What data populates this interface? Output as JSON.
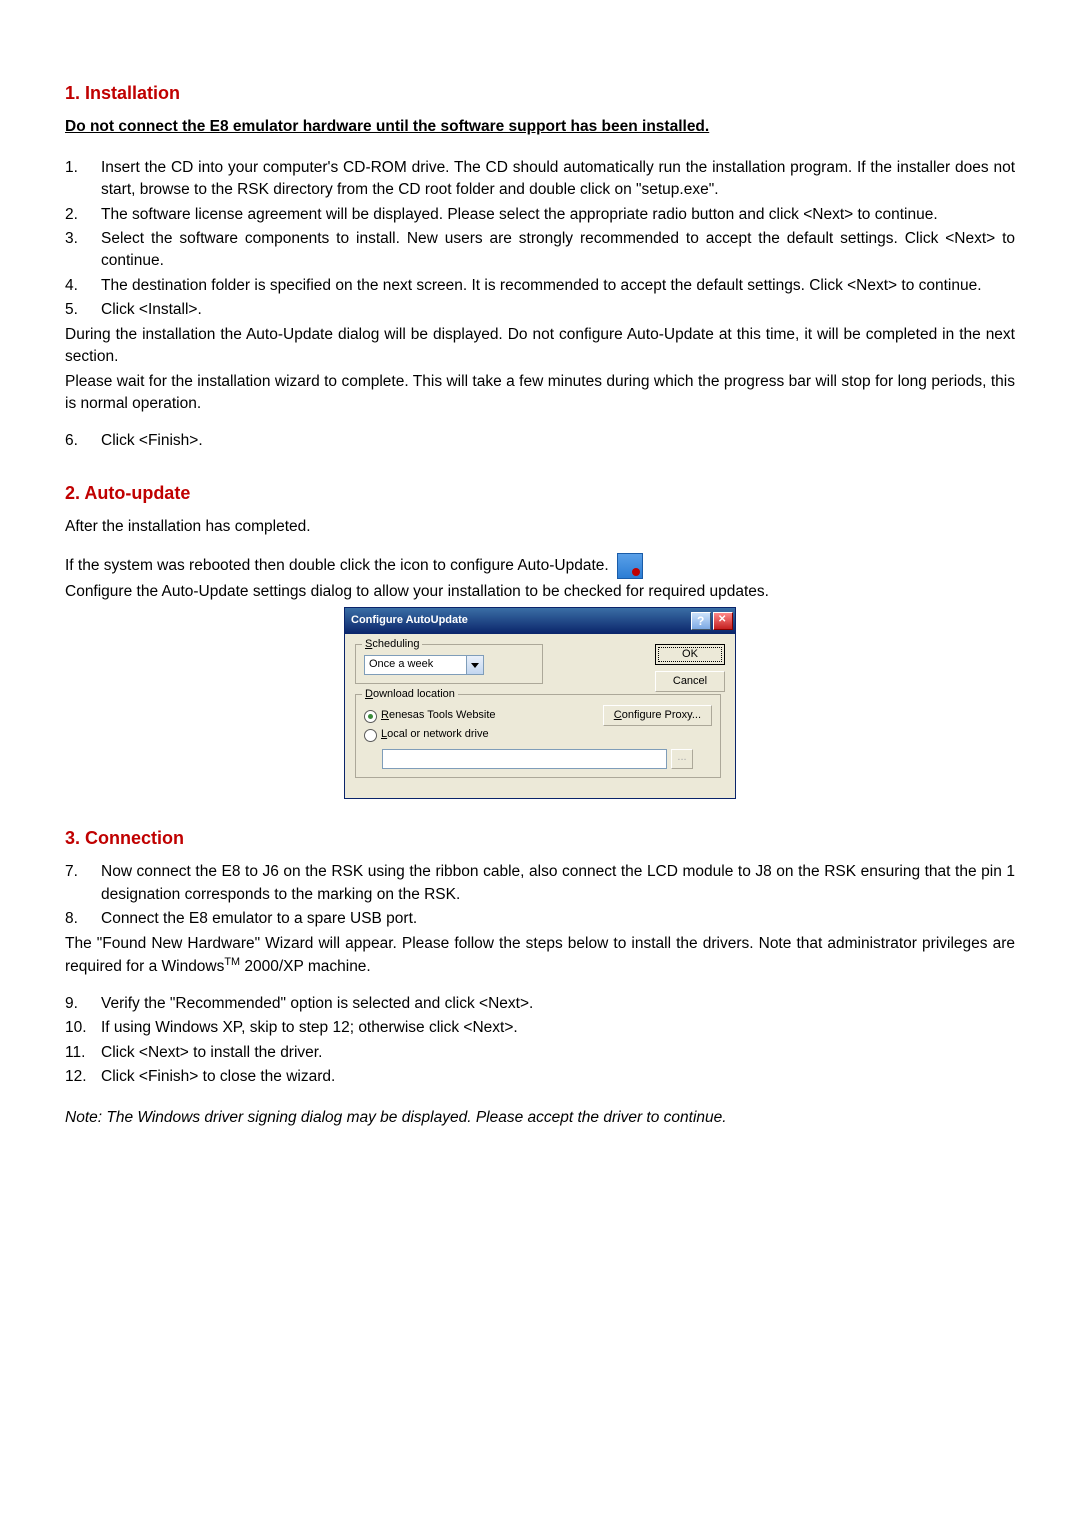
{
  "sections": {
    "s1": {
      "heading": "1. Installation"
    },
    "s2": {
      "heading": "2. Auto-update"
    },
    "s3": {
      "heading": "3. Connection"
    }
  },
  "warning": "Do not connect the E8 emulator hardware until the software support has been installed.",
  "list1": {
    "n1": "1.",
    "n2": "2.",
    "n3": "3.",
    "n4": "4.",
    "n5": "5.",
    "n6": "6.",
    "i1": "Insert the CD into your computer's CD-ROM drive. The CD should automatically run the installation program. If the installer does not start, browse to the RSK directory from the CD root folder and double click on \"setup.exe\".",
    "i2": "The software license agreement will be displayed. Please select the appropriate radio button and click <Next> to continue.",
    "i3": "Select the software components to install. New users are strongly recommended to accept the default settings. Click <Next> to continue.",
    "i4": "The destination folder is specified on the next screen. It is recommended to accept the default settings. Click <Next> to continue.",
    "i5": "Click <Install>.",
    "i6": "Click <Finish>."
  },
  "para": {
    "p1": "During the installation the Auto-Update dialog will be displayed. Do not configure Auto-Update at this time, it will be completed in the next section.",
    "p2": "Please wait for the installation wizard to complete. This will take a few minutes during which the progress bar will stop for long periods, this is normal operation.",
    "p3": "After the installation has completed.",
    "p4": "If the system was rebooted then double click the icon to configure Auto-Update.",
    "p5": "Configure the Auto-Update settings dialog to allow your installation to be checked for required updates.",
    "p6a": "The \"Found New Hardware\" Wizard will appear. Please follow the steps below to install the drivers. Note that administrator privileges are required for a Windows",
    "p6b": "TM",
    "p6c": " 2000/XP machine."
  },
  "list3": {
    "n7": "7.",
    "n8": "8.",
    "n9": "9.",
    "n10": "10.",
    "n11": "11.",
    "n12": "12.",
    "i7": "Now connect the E8 to J6 on the RSK using the ribbon cable, also connect the LCD module to J8 on the RSK ensuring that the pin 1 designation corresponds to the marking on the RSK.",
    "i8": "Connect the E8 emulator to a spare USB port.",
    "i9": "Verify the \"Recommended\" option is selected and click <Next>.",
    "i10": "If using Windows XP, skip to step 12; otherwise click <Next>.",
    "i11": "Click <Next> to install the driver.",
    "i12": "Click <Finish> to close the wizard."
  },
  "note": "Note: The Windows driver signing dialog may be displayed. Please accept the driver to continue.",
  "dialog": {
    "title": "Configure AutoUpdate",
    "scheduling_accel": "S",
    "scheduling_rest": "cheduling",
    "schedule_value": "Once a week",
    "ok": "OK",
    "cancel": "Cancel",
    "download_accel": "D",
    "download_rest": "ownload location",
    "radio1_accel": "R",
    "radio1_rest": "enesas Tools Website",
    "radio2_accel": "L",
    "radio2_rest": "ocal or network drive",
    "configure_proxy_accel": "C",
    "configure_proxy_rest": "onfigure Proxy...",
    "browse": "..."
  }
}
